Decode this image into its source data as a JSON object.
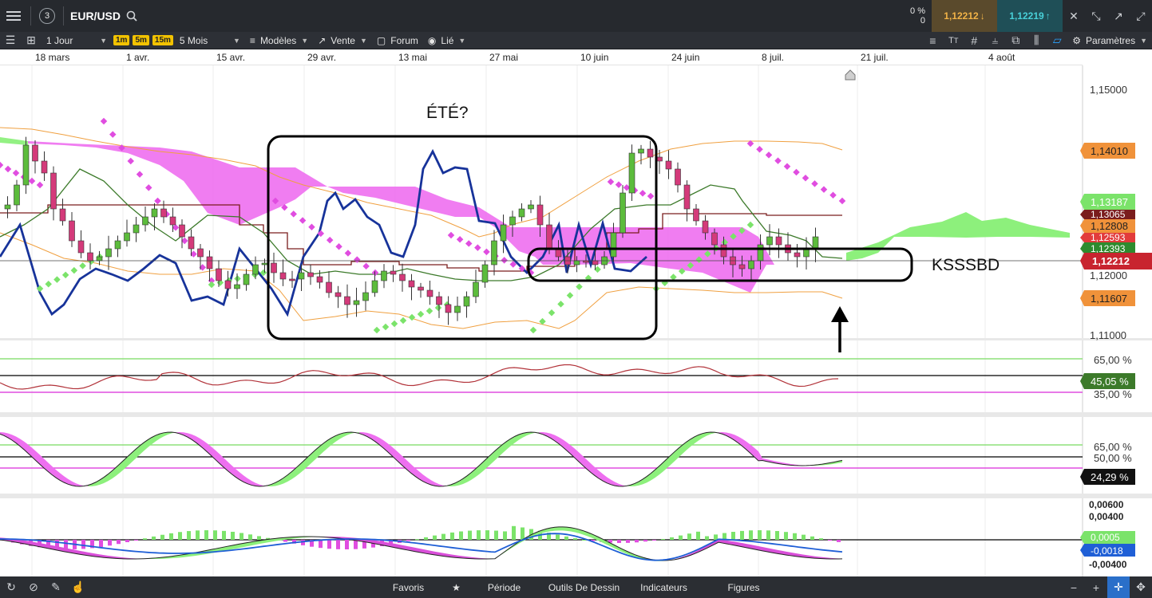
{
  "topbar": {
    "counter": "3",
    "symbol": "EUR/USD",
    "pct": "0 %",
    "pct_sub": "0",
    "sell_price": "1,12212",
    "buy_price": "1,12219"
  },
  "toolbar": {
    "period": "1 Jour",
    "tf1": "1m",
    "tf2": "5m",
    "tf3": "15m",
    "range": "5 Mois",
    "models": "Modèles",
    "sell": "Vente",
    "forum": "Forum",
    "linked": "Lié",
    "settings": "Paramètres"
  },
  "dates": [
    "18 mars",
    "1 avr.",
    "15 avr.",
    "29 avr.",
    "13 mai",
    "27 mai",
    "10 juin",
    "24 juin",
    "8 juil.",
    "21 juil.",
    "4 août"
  ],
  "annotations": {
    "ete": "ÉTÉ?",
    "ksssbd": "KSSSBD"
  },
  "price_axis": {
    "ticks": [
      "1,15000",
      "1,12000",
      "1,11000"
    ],
    "labels": [
      {
        "text": "1,14010",
        "color": "#f0923a"
      },
      {
        "text": "1,13187",
        "color": "#7be36a"
      },
      {
        "text": "1,13065",
        "color": "#7a1d1d"
      },
      {
        "text": "1,12808",
        "color": "#f0923a"
      },
      {
        "text": "1,12593",
        "color": "#e23b3b"
      },
      {
        "text": "1,12393",
        "color": "#2e8b2e"
      },
      {
        "text": "1,12212",
        "color": "#c8242f"
      },
      {
        "text": "1,11607",
        "color": "#f0923a"
      }
    ]
  },
  "indicators": {
    "rsi": {
      "hi": "65,00 %",
      "val": "45,05 %",
      "lo": "35,00 %"
    },
    "stoch": {
      "hi": "65,00 %",
      "mid": "50,00 %",
      "val": "24,29 %"
    },
    "macd": {
      "t1": "0,00600",
      "t2": "0,00400",
      "t3": "0,0005",
      "val": "-0,0018",
      "t4": "-0,00400"
    }
  },
  "bottombar": {
    "favorites": "Favoris",
    "period": "Période",
    "drawing_tools": "Outils De Dessin",
    "indicators": "Indicateurs",
    "figures": "Figures"
  },
  "colors": {
    "bull": "#5cbc3c",
    "bear": "#d43a7a",
    "cloud": "#ee6ff0",
    "cloud_green": "#8df07c",
    "line_blue": "#17339a"
  }
}
